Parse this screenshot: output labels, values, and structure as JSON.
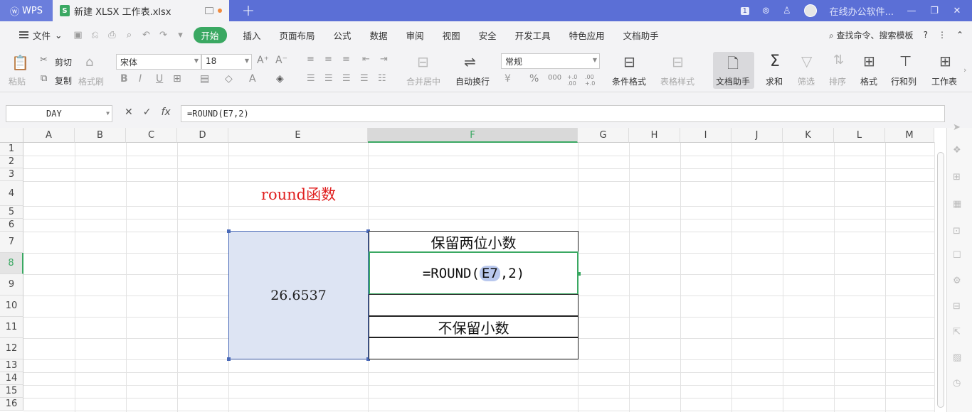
{
  "titlebar": {
    "app_name": "WPS",
    "doc_title": "新建 XLSX 工作表.xlsx",
    "doc_icon": "S",
    "add_tab": "+",
    "badge": "1",
    "online_label": "在线办公软件...",
    "brand_color": "#5b6fd6"
  },
  "menubar": {
    "file": "文件",
    "start": "开始",
    "items": [
      "插入",
      "页面布局",
      "公式",
      "数据",
      "审阅",
      "视图",
      "安全",
      "开发工具",
      "特色应用",
      "文档助手"
    ],
    "search": "查找命令、搜索模板",
    "help": "?",
    "accent_color": "#3aa862"
  },
  "ribbon": {
    "paste": "粘贴",
    "cut": "剪切",
    "copy": "复制",
    "format_painter": "格式刷",
    "font_name": "宋体",
    "font_size": "18",
    "font_grow": "A⁺",
    "font_shrink": "A⁻",
    "bold": "B",
    "italic": "I",
    "underline": "U",
    "merge_center": "合并居中",
    "wrap_text": "自动换行",
    "number_format": "常规",
    "percent": "%",
    "thousands": "000",
    "inc_decimal": "+.0 .00",
    "dec_decimal": ".00 +.0",
    "conditional_format": "条件格式",
    "table_style": "表格样式",
    "doc_helper": "文档助手",
    "sum": "求和",
    "filter": "筛选",
    "sort": "排序",
    "format": "格式",
    "row_col": "行和列",
    "worksheet": "工作表"
  },
  "formulabar": {
    "name_box": "DAY",
    "formula": "=ROUND(E7,2)",
    "fx": "fx"
  },
  "grid": {
    "columns": [
      "A",
      "B",
      "C",
      "D",
      "E",
      "F",
      "G",
      "H",
      "I",
      "J",
      "K",
      "L",
      "M"
    ],
    "rows": [
      "1",
      "2",
      "3",
      "4",
      "5",
      "6",
      "7",
      "8",
      "9",
      "10",
      "11",
      "12",
      "13",
      "14",
      "15",
      "16"
    ],
    "selected_column": "F",
    "selected_row": "8"
  },
  "cells": {
    "title": "round函数",
    "value": "26.6537",
    "keep_two": "保留两位小数",
    "formula_prefix": "=ROUND(",
    "formula_ref": "E7",
    "formula_suffix": ",2)",
    "no_decimal": "不保留小数"
  }
}
